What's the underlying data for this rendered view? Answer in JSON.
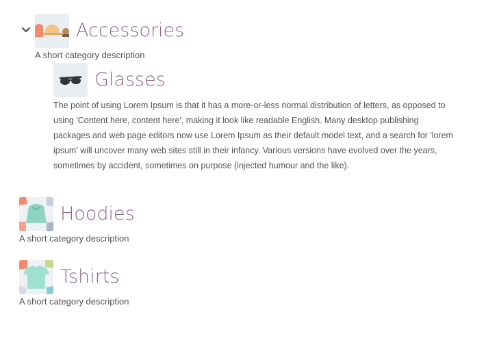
{
  "categories": {
    "accessories": {
      "title": "Accessories",
      "description": "A short category description",
      "toggle_icon": "chevron-down-icon"
    },
    "glasses": {
      "title": "Glasses",
      "description": "The point of using Lorem Ipsum is that it has a more-or-less normal distribution of letters, as opposed to using 'Content here, content here', making it look like readable English. Many desktop publishing packages and web page editors now use Lorem Ipsum as their default model text, and a search for 'lorem ipsum' will uncover many web sites still in their infancy. Various versions have evolved over the years, sometimes by accident, sometimes on purpose (injected humour and the like)."
    },
    "hoodies": {
      "title": "Hoodies",
      "description": "A short category description"
    },
    "tshirts": {
      "title": "Tshirts",
      "description": "A short category description"
    }
  },
  "colors": {
    "title_link": "#8e6286",
    "text": "#515151",
    "thumb_bg": "#e9eef3"
  }
}
